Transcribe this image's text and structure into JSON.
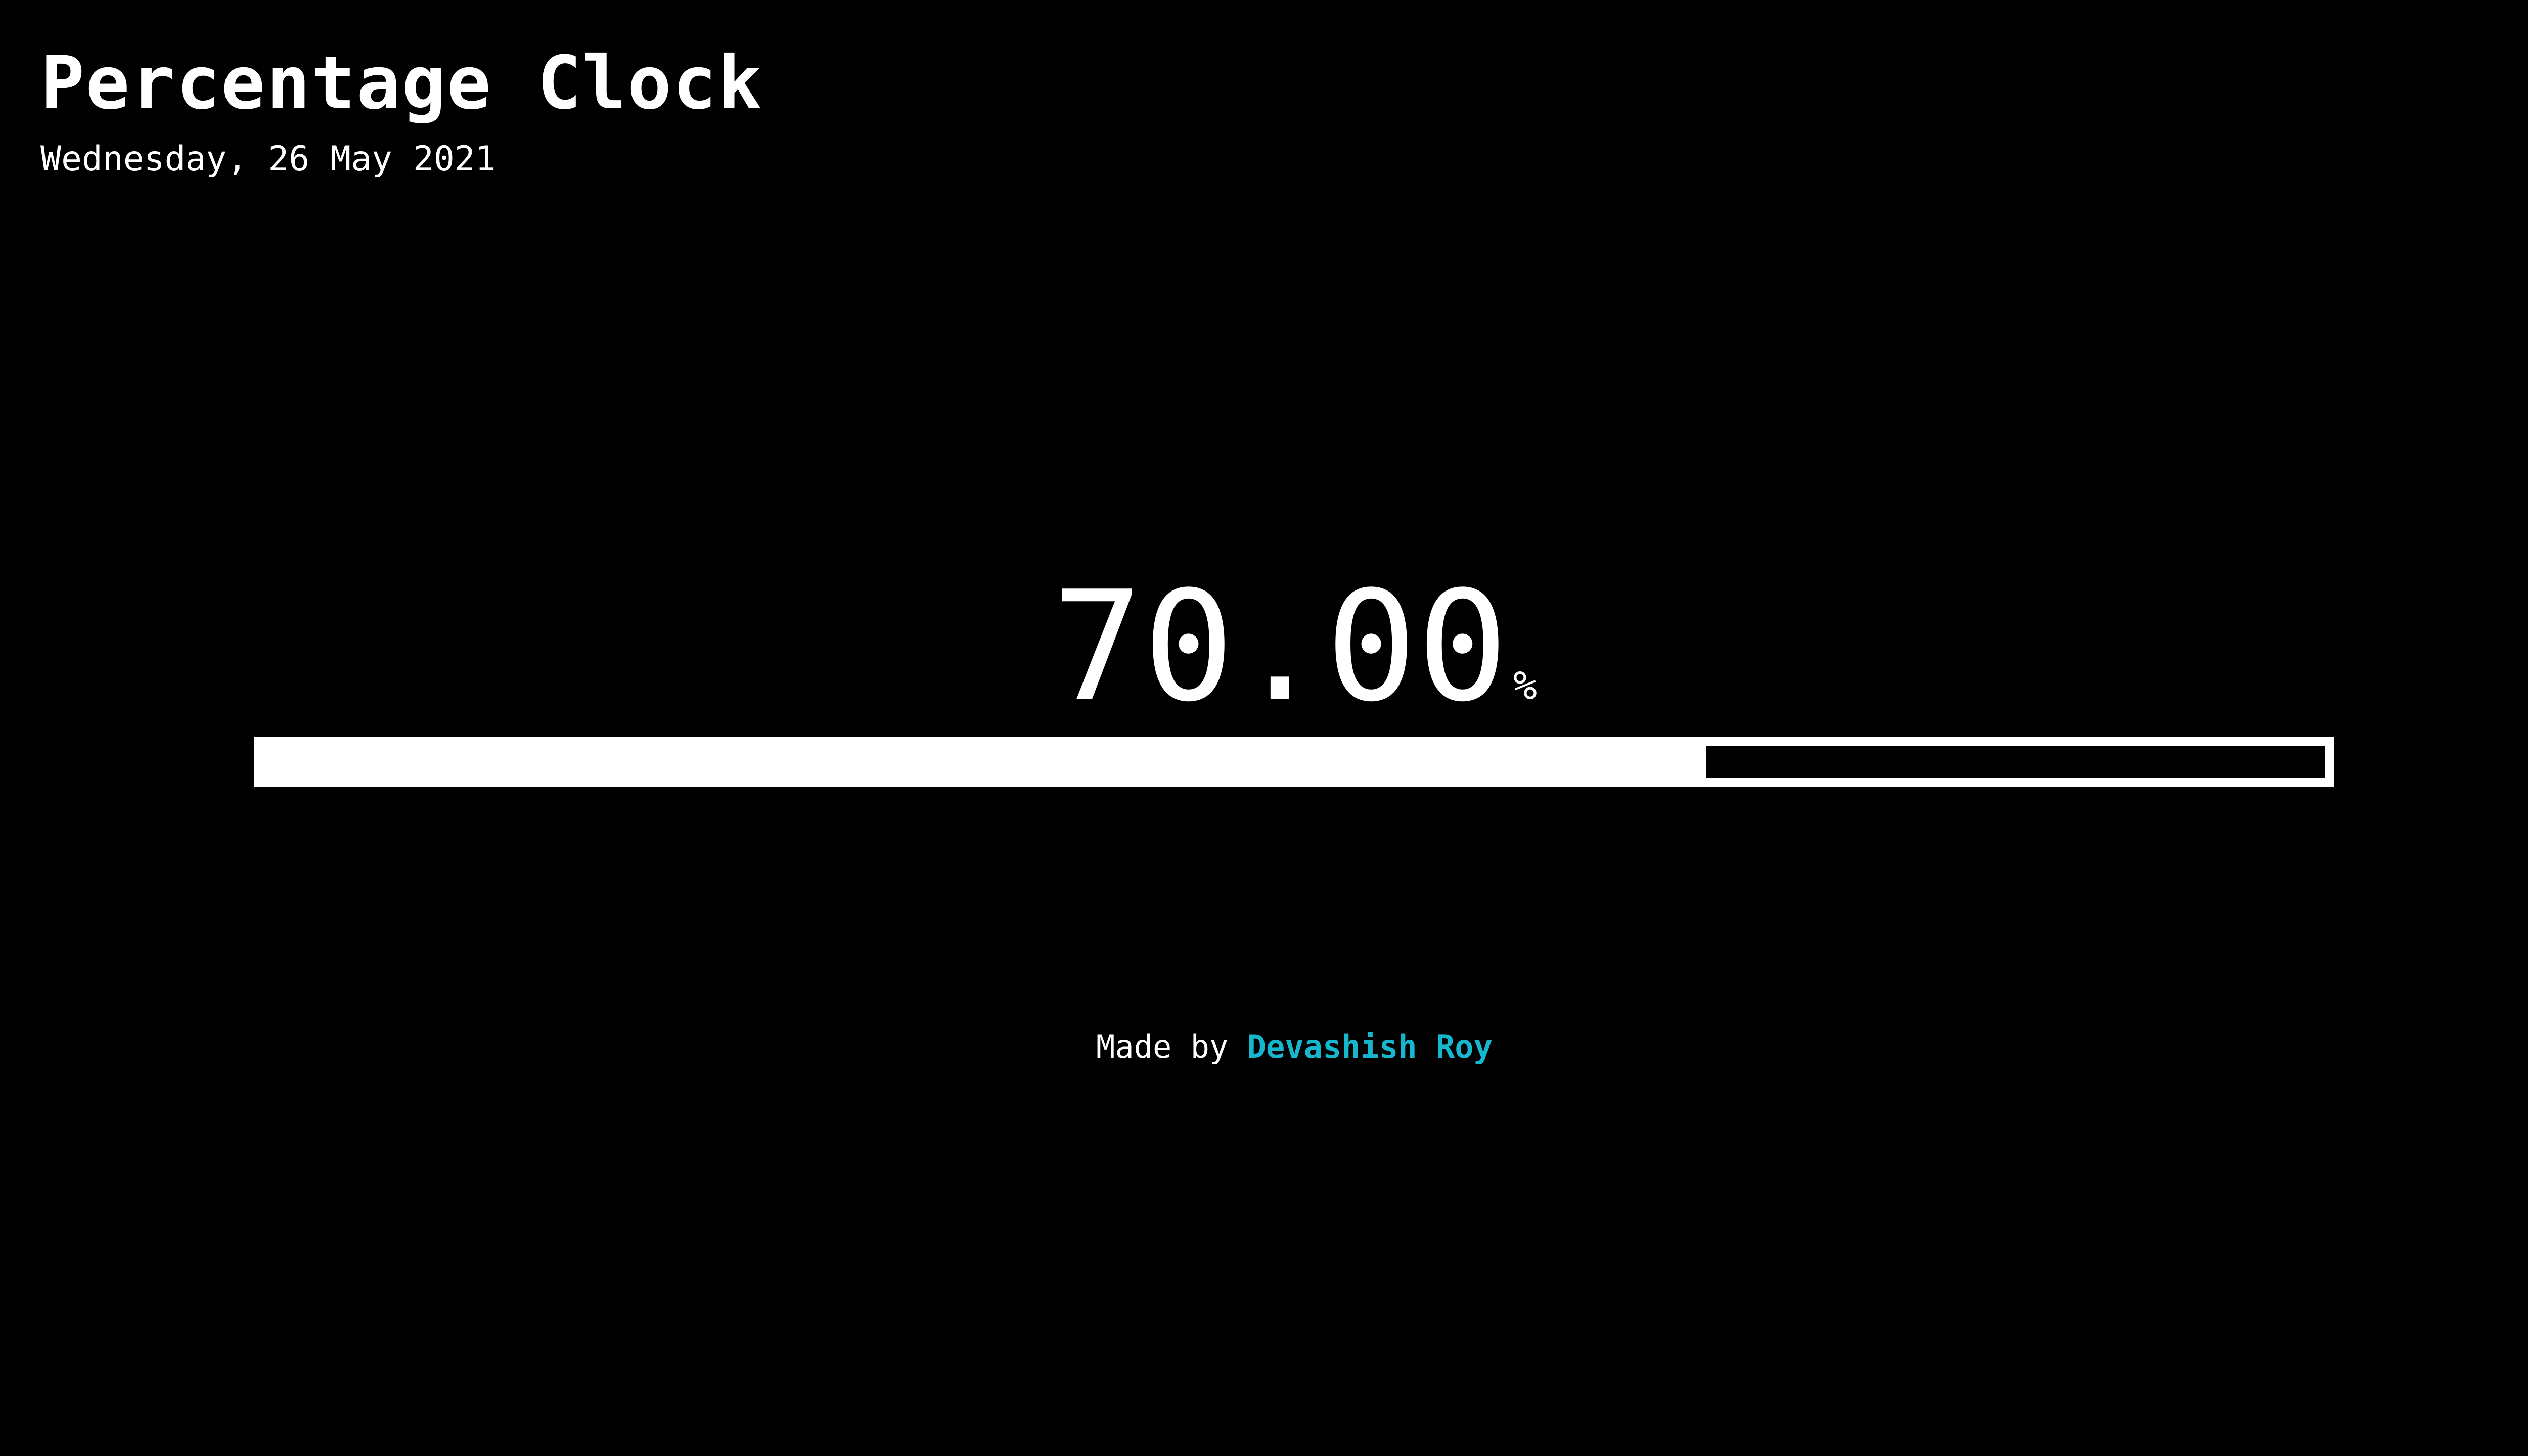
{
  "header": {
    "title": "Percentage Clock",
    "date": "Wednesday, 26 May 2021"
  },
  "clock": {
    "value": "70.00",
    "unit": "%",
    "progress_fraction": 0.7
  },
  "footer": {
    "prefix": "Made by",
    "author": "Devashish Roy"
  },
  "colors": {
    "background": "#000000",
    "foreground": "#ffffff",
    "link": "#17b6cf"
  }
}
